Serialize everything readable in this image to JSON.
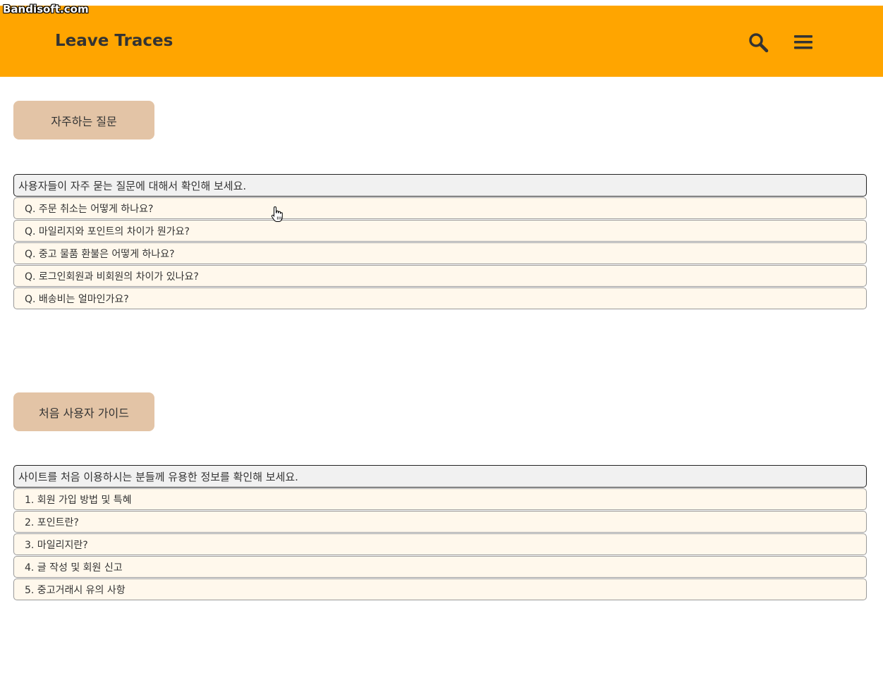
{
  "watermark": "Bandisoft.com",
  "header": {
    "brand": "Leave Traces",
    "icons": {
      "search": "search-icon",
      "menu": "hamburger-menu-icon"
    },
    "bg_color": "#ffa500"
  },
  "faq": {
    "button_label": "자주하는 질문",
    "heading": "사용자들이 자주 묻는 질문에 대해서 확인해 보세요.",
    "items": [
      "Q. 주문 취소는 어떻게 하나요?",
      "Q. 마일리지와 포인트의 차이가 뭔가요?",
      "Q. 중고 물품 환불은 어떻게 하나요?",
      "Q. 로그인회원과 비회원의 차이가 있나요?",
      "Q. 배송비는 얼마인가요?"
    ]
  },
  "guide": {
    "button_label": "처음 사용자 가이드",
    "heading": "사이트를 처음 이용하시는 분들께 유용한 정보를 확인해 보세요.",
    "items": [
      "1. 회원 가입 방법 및 특혜",
      "2. 포인트란?",
      "3. 마일리지란?",
      "4. 글 작성 및 회원 신고",
      "5. 중고거래시 유의 사항"
    ]
  },
  "colors": {
    "section_button": "#e3c4a6",
    "item_bg": "#fff8ec",
    "heading_bg": "#f1f1f1"
  }
}
